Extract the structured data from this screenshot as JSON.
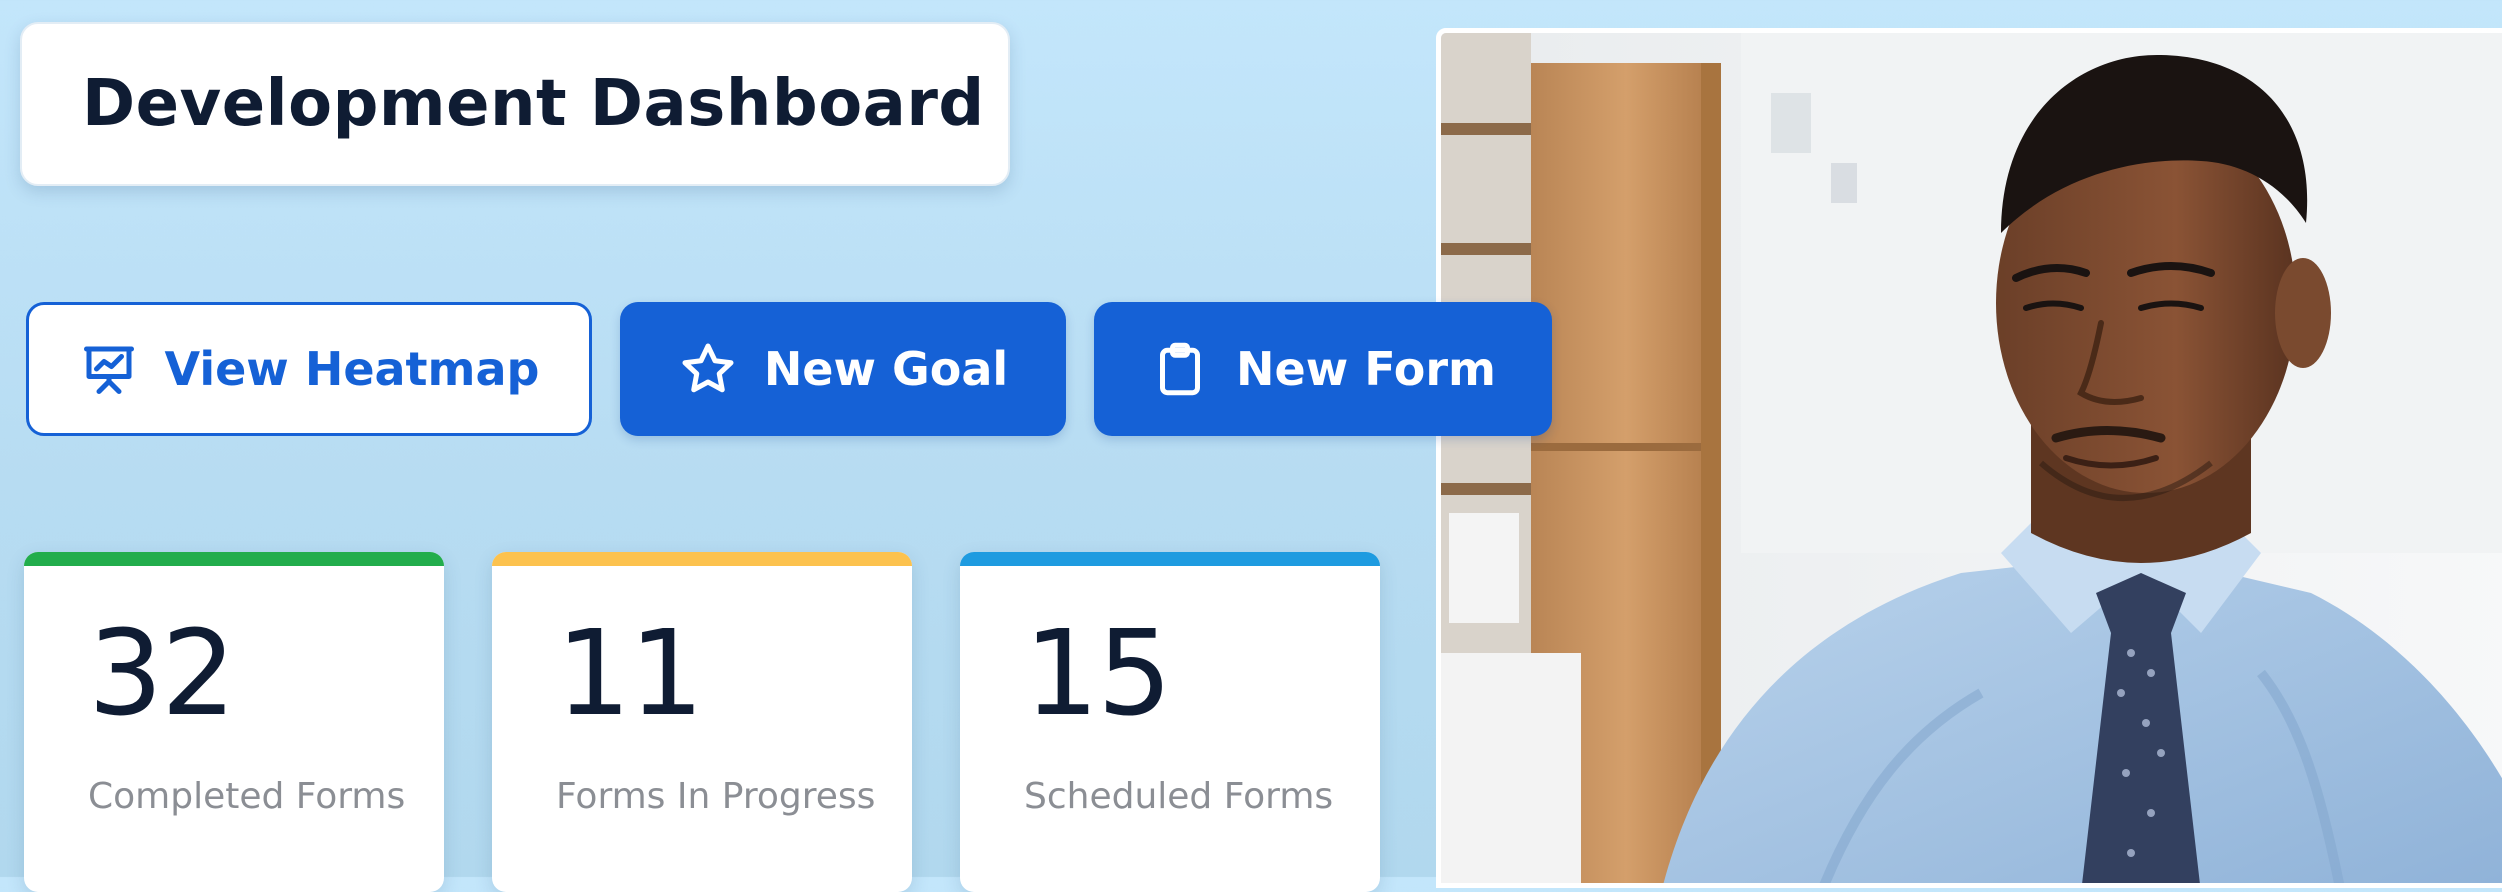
{
  "header": {
    "title": "Development Dashboard"
  },
  "actions": [
    {
      "label": "View Heatmap",
      "icon": "presentation-chart-icon",
      "style": "outline"
    },
    {
      "label": "New Goal",
      "icon": "star-icon",
      "style": "solid"
    },
    {
      "label": "New Form",
      "icon": "clipboard-icon",
      "style": "solid"
    }
  ],
  "stats": [
    {
      "value": "32",
      "label": "Completed Forms",
      "accent": "#22ad4c"
    },
    {
      "value": "11",
      "label": "Forms In Progress",
      "accent": "#fcc24e"
    },
    {
      "value": "15",
      "label": "Scheduled Forms",
      "accent": "#1e9be0"
    }
  ],
  "colors": {
    "primary": "#1561d6",
    "background": "#c3e6fb",
    "title_text": "#0f1c33",
    "label_text": "#8b8e94"
  },
  "photo": {
    "icon": "person-at-desk-photo"
  }
}
